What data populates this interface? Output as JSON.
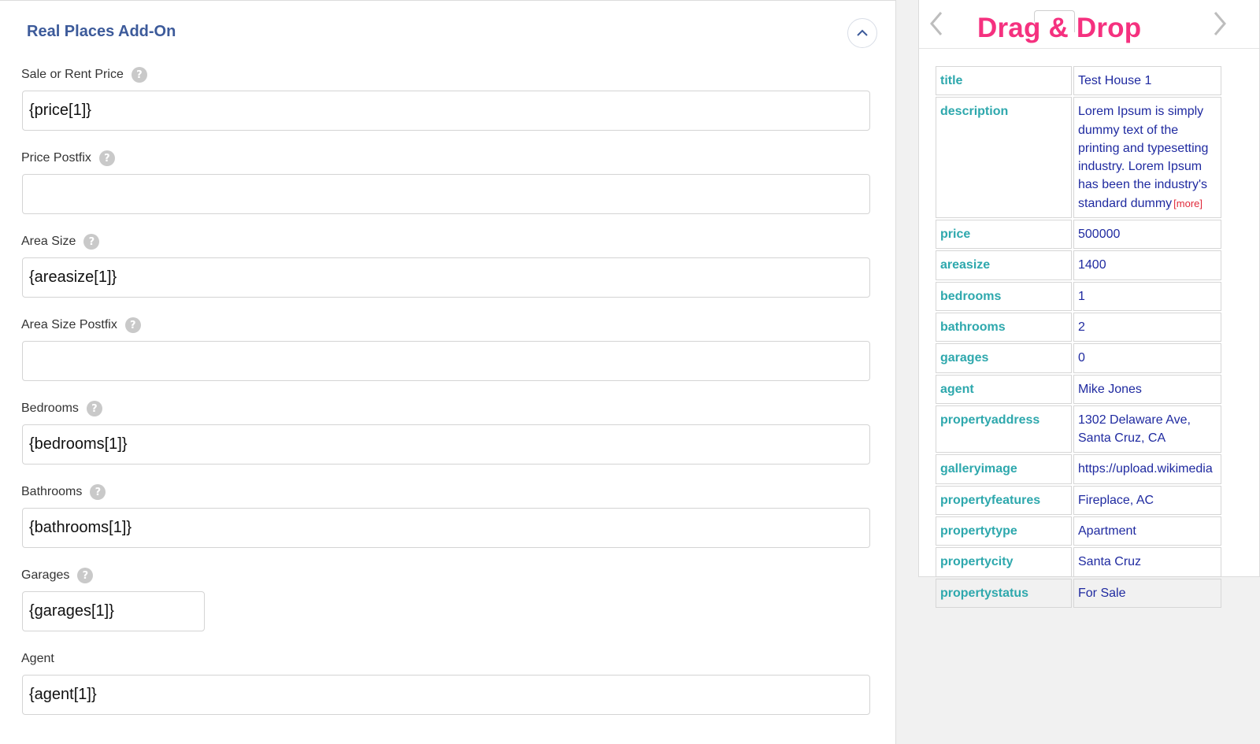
{
  "addon": {
    "title": "Real Places Add-On",
    "fields": [
      {
        "label": "Sale or Rent Price",
        "value": "{price[1]}",
        "has_help": true
      },
      {
        "label": "Price Postfix",
        "value": "",
        "has_help": true
      },
      {
        "label": "Area Size",
        "value": "{areasize[1]}",
        "has_help": true
      },
      {
        "label": "Area Size Postfix",
        "value": "",
        "has_help": true
      },
      {
        "label": "Bedrooms",
        "value": "{bedrooms[1]}",
        "has_help": true
      },
      {
        "label": "Bathrooms",
        "value": "{bathrooms[1]}",
        "has_help": true
      },
      {
        "label": "Garages",
        "value": "{garages[1]}",
        "has_help": true
      },
      {
        "label": "Agent",
        "value": "{agent[1]}",
        "has_help": false
      }
    ],
    "help_glyph": "?"
  },
  "drag_drop": {
    "title": "Drag & Drop",
    "rows": [
      {
        "key": "title",
        "value": "Test House 1"
      },
      {
        "key": "description",
        "value": "Lorem Ipsum is simply dummy text of the printing and typesetting industry. Lorem Ipsum has been the industry's standard dummy",
        "more": "[more]"
      },
      {
        "key": "price",
        "value": "500000"
      },
      {
        "key": "areasize",
        "value": "1400"
      },
      {
        "key": "bedrooms",
        "value": "1"
      },
      {
        "key": "bathrooms",
        "value": "2"
      },
      {
        "key": "garages",
        "value": "0"
      },
      {
        "key": "agent",
        "value": "Mike Jones"
      },
      {
        "key": "propertyaddress",
        "value": "1302 Delaware Ave, Santa Cruz, CA"
      },
      {
        "key": "galleryimage",
        "value": "https://upload.wikimedia"
      },
      {
        "key": "propertyfeatures",
        "value": "Fireplace, AC"
      },
      {
        "key": "propertytype",
        "value": "Apartment"
      },
      {
        "key": "propertycity",
        "value": "Santa Cruz"
      },
      {
        "key": "propertystatus",
        "value": "For Sale"
      }
    ]
  },
  "icons": {
    "collapse": "chevron-up-icon",
    "prev": "chevron-left-icon",
    "next": "chevron-right-icon",
    "help": "help-icon"
  },
  "colors": {
    "title_blue": "#3c5a9a",
    "key_teal": "#2ea8ad",
    "value_navy": "#1f2aa0",
    "drag_pink": "#f5317f",
    "more_red": "#e0293a"
  }
}
